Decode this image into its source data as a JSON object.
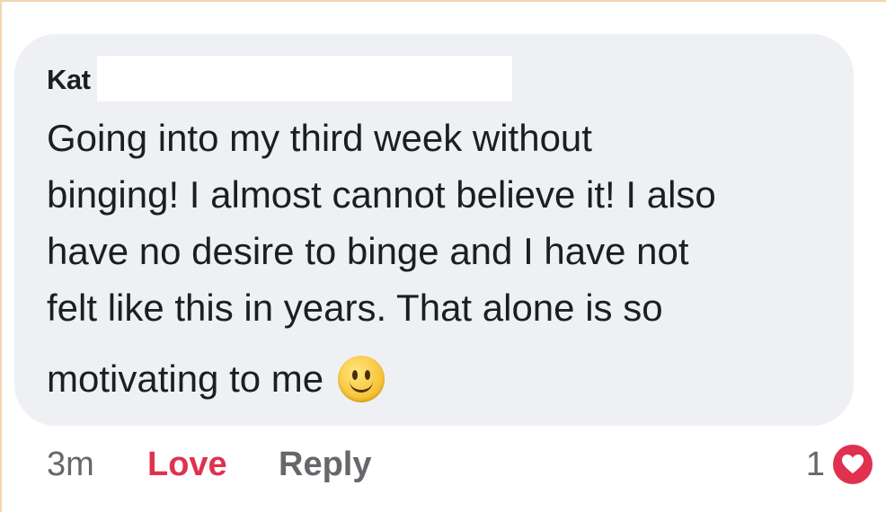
{
  "comment": {
    "author": "Kat",
    "text_lines": [
      "Going into my third week without",
      "binging! I almost cannot believe it! I also",
      "have no desire to binge and I have not",
      "felt like this in years. That alone is so",
      "motivating to me"
    ],
    "emoji": "slightly-smiling-face-icon"
  },
  "actions": {
    "timestamp": "3m",
    "love_label": "Love",
    "reply_label": "Reply"
  },
  "reactions": {
    "count": "1",
    "icon": "heart-icon",
    "color": "#e0314f"
  },
  "colors": {
    "bubble": "#eff0f4",
    "accent": "#e0314f",
    "muted": "#65676b"
  }
}
